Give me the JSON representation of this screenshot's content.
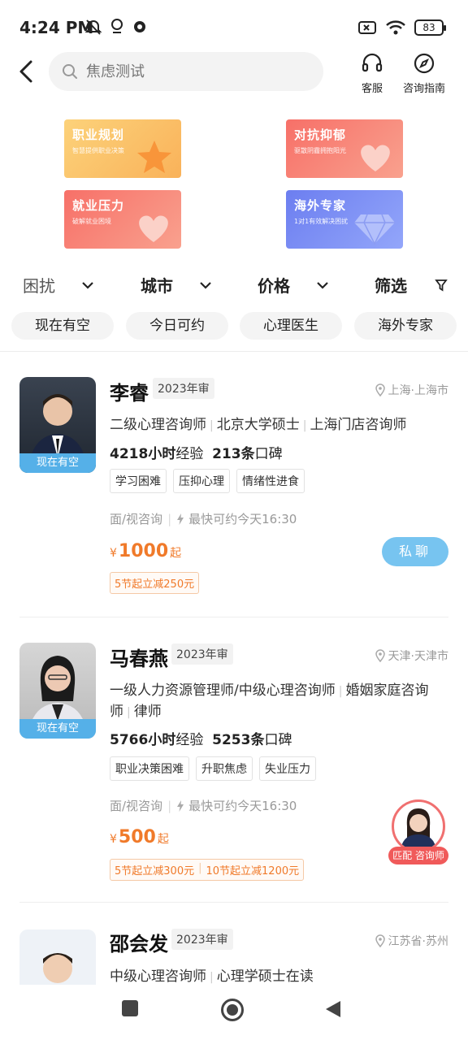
{
  "status_bar": {
    "time": "4:24 PM",
    "battery": "83"
  },
  "header": {
    "search_placeholder": "焦虑测试",
    "actions": [
      {
        "label": "客服",
        "icon": "headset-icon"
      },
      {
        "label": "咨询指南",
        "icon": "compass-icon"
      }
    ]
  },
  "banners": [
    {
      "title": "职业规划",
      "subtitle": "智慧提供职业决策",
      "color_from": "#fcc868",
      "color_to": "#fbb055"
    },
    {
      "title": "对抗抑郁",
      "subtitle": "驱散阴霾拥抱阳光",
      "color_from": "#f87a72",
      "color_to": "#f8a08d"
    },
    {
      "title": "就业压力",
      "subtitle": "破解就业困境",
      "color_from": "#f77c72",
      "color_to": "#f9a38f"
    },
    {
      "title": "海外专家",
      "subtitle": "1对1有效解决困扰",
      "color_from": "#6b7df0",
      "color_to": "#8fa2f8"
    }
  ],
  "filters": [
    {
      "label": "困扰"
    },
    {
      "label": "城市"
    },
    {
      "label": "价格"
    },
    {
      "label": "筛选"
    }
  ],
  "chips": [
    "现在有空",
    "今日可约",
    "心理医生",
    "海外专家"
  ],
  "counselors": [
    {
      "name": "李睿",
      "year": "2023年审",
      "location": "上海·上海市",
      "availability": "现在有空",
      "quals": [
        "二级心理咨询师",
        "北京大学硕士",
        "上海门店咨询师"
      ],
      "hours": "4218小时",
      "hours_suffix": "经验",
      "reviews": "213条",
      "reviews_suffix": "口碑",
      "tags": [
        "学习困难",
        "压抑心理",
        "情绪性进食"
      ],
      "mode": "面/视咨询",
      "earliest": "最快可约今天16:30",
      "price_symbol": "¥",
      "price": "1000",
      "price_suffix": "起",
      "discounts": [
        "5节起立减250元"
      ],
      "chat_label": "私聊"
    },
    {
      "name": "马春燕",
      "year": "2023年审",
      "location": "天津·天津市",
      "availability": "现在有空",
      "quals": [
        "一级人力资源管理师/中级心理咨询师",
        "婚姻家庭咨询师",
        "律师"
      ],
      "hours": "5766小时",
      "hours_suffix": "经验",
      "reviews": "5253条",
      "reviews_suffix": "口碑",
      "tags": [
        "职业决策困难",
        "升职焦虑",
        "失业压力"
      ],
      "mode": "面/视咨询",
      "earliest": "最快可约今天16:30",
      "price_symbol": "¥",
      "price": "500",
      "price_suffix": "起",
      "discounts": [
        "5节起立减300元",
        "10节起立减1200元"
      ]
    },
    {
      "name": "邵会发",
      "year": "2023年审",
      "location": "江苏省·苏州",
      "quals": [
        "中级心理咨询师",
        "心理学硕士在读"
      ]
    }
  ],
  "float_consult": {
    "label": "匹配 咨询师"
  },
  "colors": {
    "accent_blue": "#55b0e8",
    "price_orange": "#f07a2a",
    "chat_button": "#77c4f0"
  }
}
